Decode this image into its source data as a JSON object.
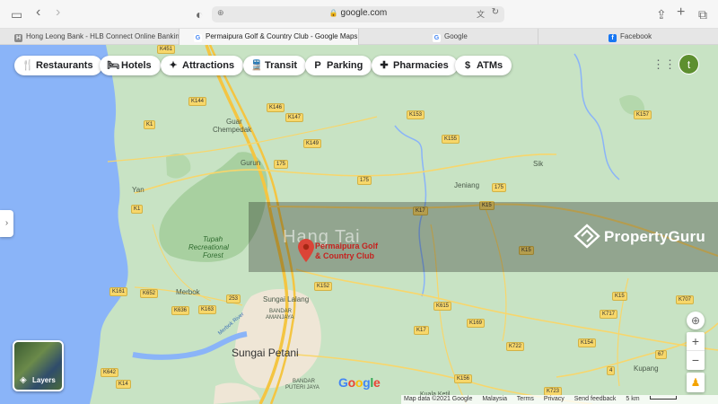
{
  "browser": {
    "url": "google.com",
    "tabs": [
      {
        "label": "Hong Leong Bank - HLB Connect Online Banking",
        "favicon": "H",
        "color": "#8a8a8a"
      },
      {
        "label": "Permaipura Golf & Country Club - Google Maps",
        "favicon": "G",
        "color": "#4285f4"
      },
      {
        "label": "Google",
        "favicon": "G",
        "color": "#4285f4"
      },
      {
        "label": "Facebook",
        "favicon": "f",
        "color": "#1877f2"
      }
    ]
  },
  "chips": [
    {
      "label": "Restaurants",
      "icon": "🍴"
    },
    {
      "label": "Hotels",
      "icon": "🛏"
    },
    {
      "label": "Attractions",
      "icon": "✦"
    },
    {
      "label": "Transit",
      "icon": "🚆"
    },
    {
      "label": "Parking",
      "icon": "P"
    },
    {
      "label": "Pharmacies",
      "icon": "✚"
    },
    {
      "label": "ATMs",
      "icon": "$"
    }
  ],
  "account": {
    "initial": "t",
    "color": "#5d8f2f"
  },
  "place": {
    "name_line1": "Permaipura Golf",
    "name_line2": "& Country Club",
    "pin_color": "#db4437"
  },
  "watermark": {
    "brand": "PropertyGuru",
    "ghost_text": "Hang Tai"
  },
  "map_labels": {
    "guar": "Guar",
    "chempedak": "Chempedak",
    "gurun": "Gurun",
    "yan": "Yan",
    "jeniang": "Jeniang",
    "sik": "Sik",
    "tupah1": "Tupah",
    "tupah2": "Recreational",
    "tupah3": "Forest",
    "merbok": "Merbok",
    "sungai_lalang": "Sungai Lalang",
    "bandar1": "BANDAR",
    "bandar2": "AMANJAYA",
    "sungai_petani": "Sungai Petani",
    "puteri1": "BANDAR",
    "puteri2": "PUTERI JAYA",
    "kupang": "Kupang",
    "kuala_ketil": "Kuala Ketil",
    "river": "Merbok River"
  },
  "road_tags": [
    "K451",
    "K144",
    "K146",
    "K147",
    "K1",
    "K149",
    "K153",
    "K155",
    "175",
    "175",
    "175",
    "K17",
    "K15",
    "K15",
    "K1",
    "K161",
    "K652",
    "253",
    "K636",
    "K163",
    "K152",
    "K615",
    "K169",
    "K17",
    "K722",
    "K154",
    "K642",
    "K14",
    "K156",
    "K723",
    "4",
    "67",
    "K15",
    "K707",
    "K717",
    "K157"
  ],
  "layers": {
    "label": "Layers"
  },
  "controls": {
    "zoom_in": "+",
    "zoom_out": "−"
  },
  "footer": {
    "map_data": "Map data ©2021 Google",
    "country": "Malaysia",
    "terms": "Terms",
    "privacy": "Privacy",
    "feedback": "Send feedback",
    "scale": "5 km"
  },
  "google_logo": [
    "G",
    "o",
    "o",
    "g",
    "l",
    "e"
  ],
  "colors": {
    "water": "#8ab4f8",
    "urban": "#efe6d6",
    "forest": "#a8d0a0",
    "road": "#f8d66b",
    "highway": "#f4c542"
  }
}
